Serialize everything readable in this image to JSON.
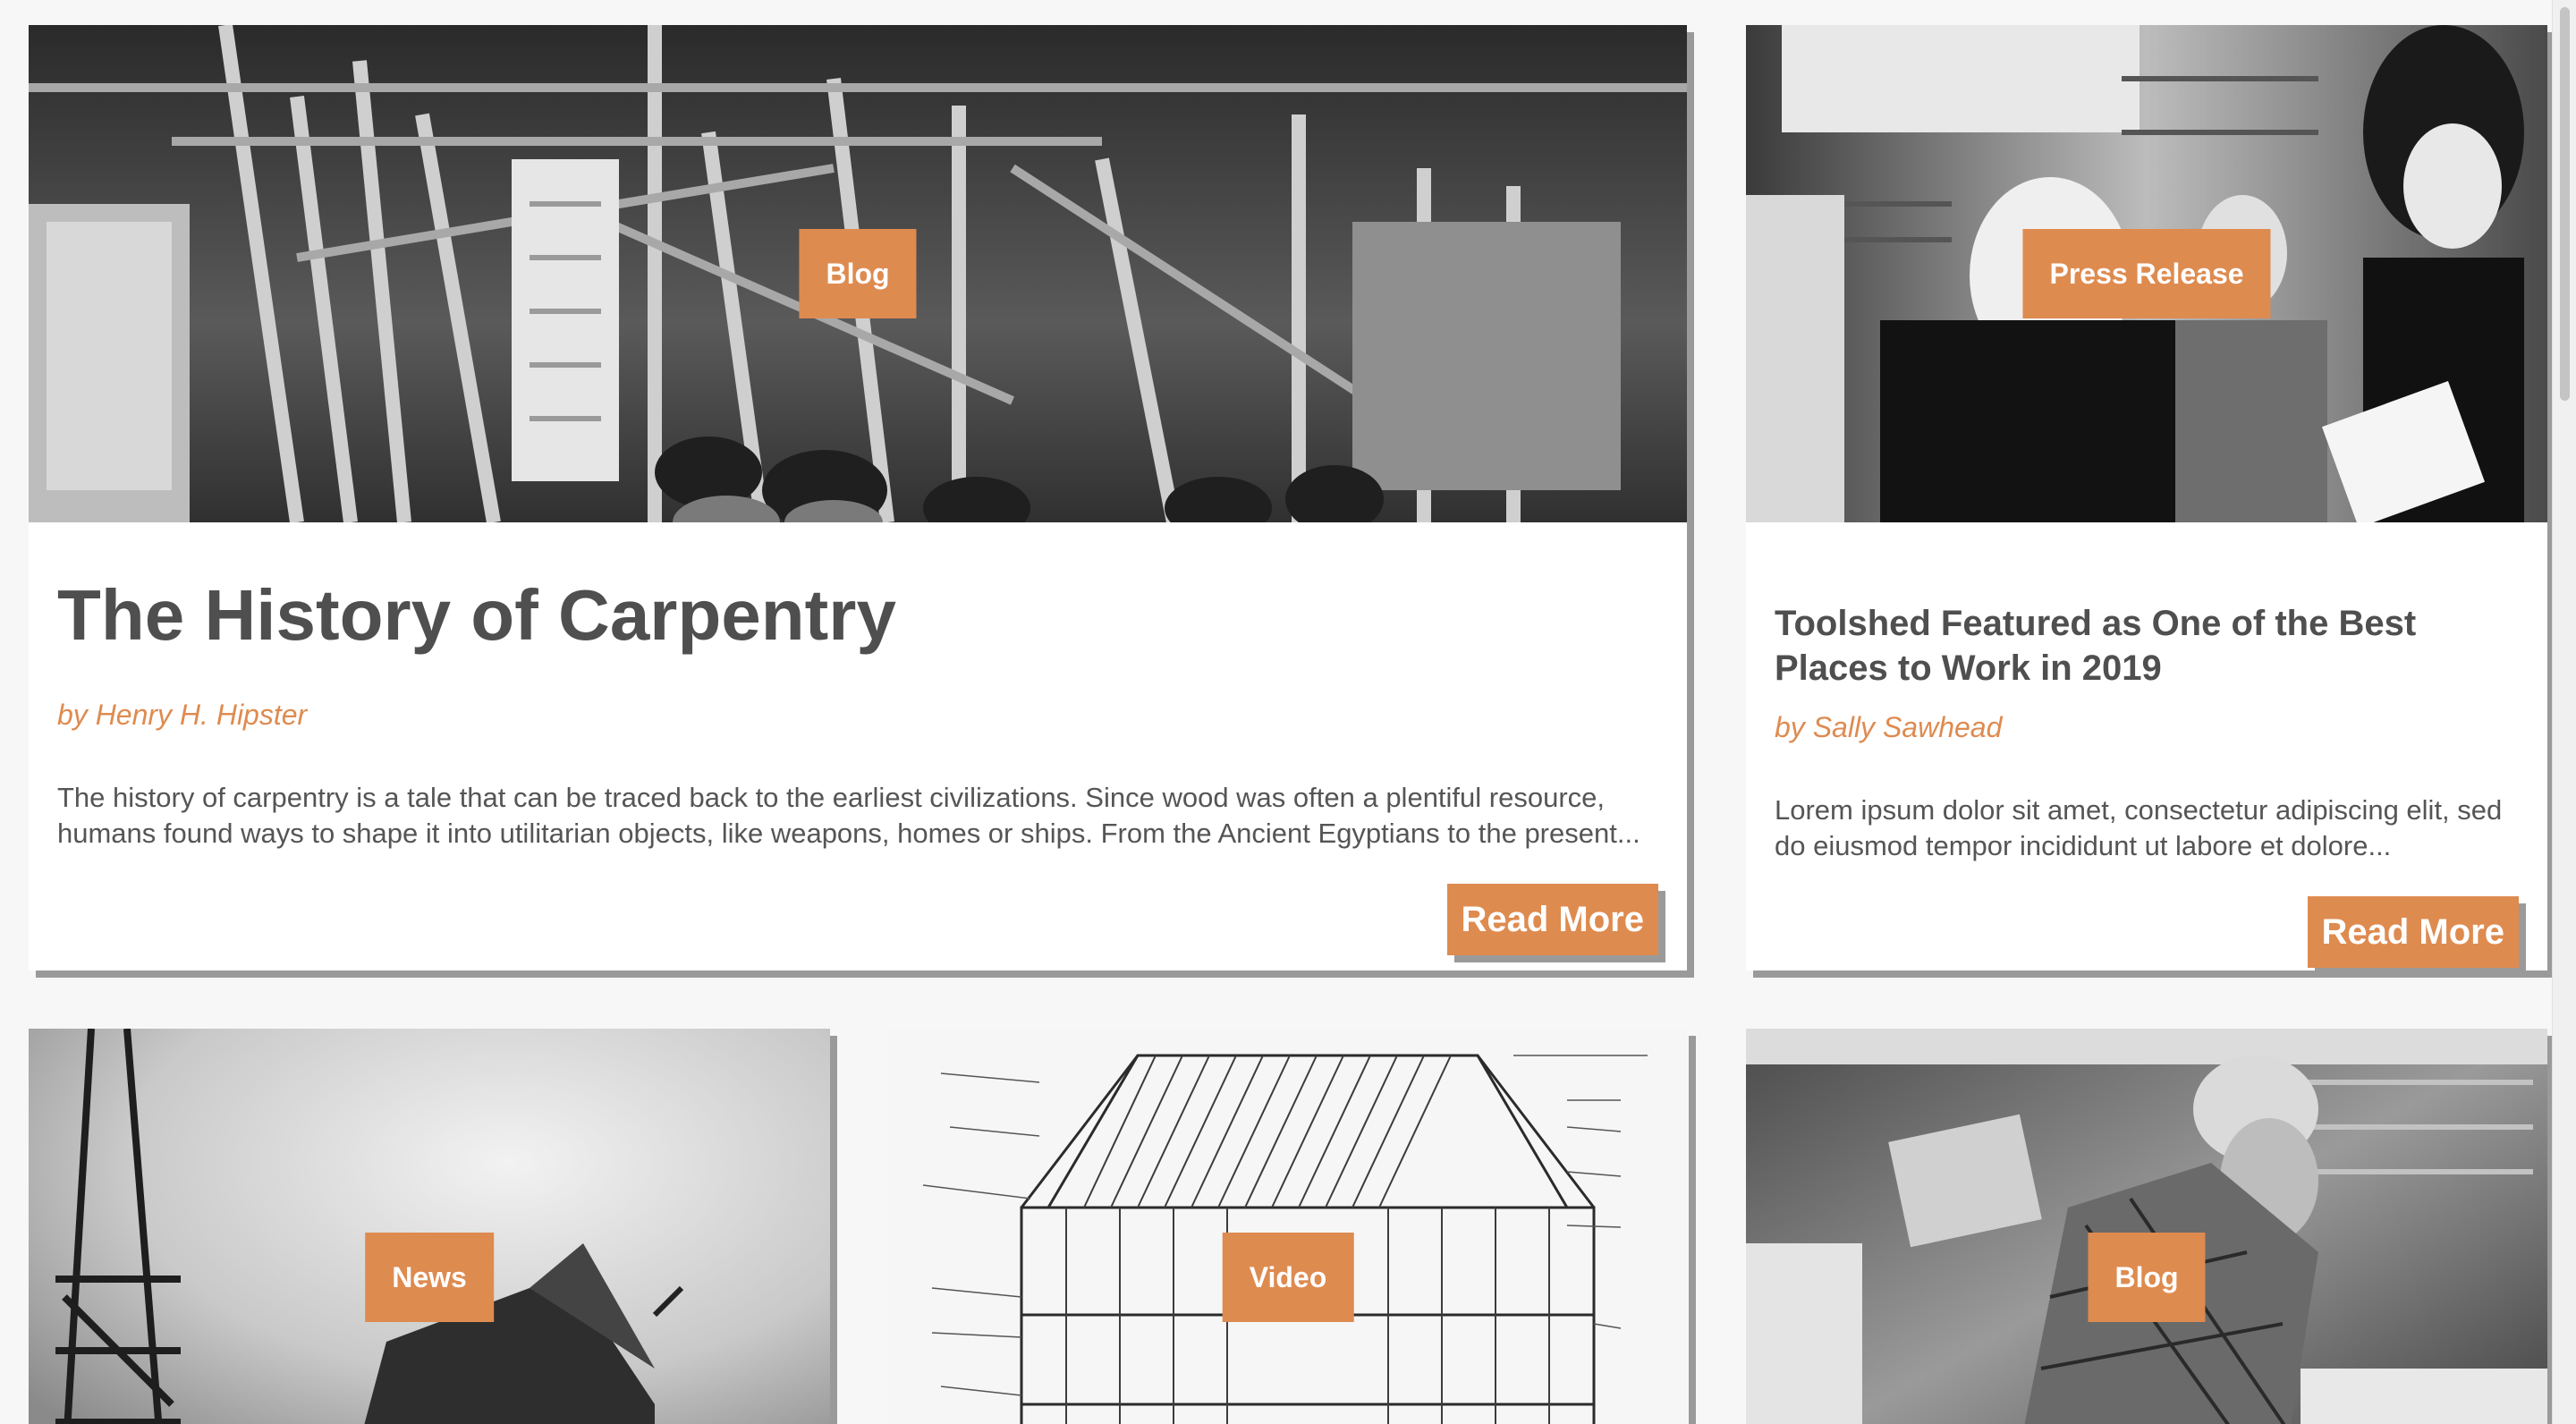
{
  "featured_card": {
    "category": "Blog",
    "title": "The History of Carpentry",
    "author": "by Henry H. Hipster",
    "excerpt": "The history of carpentry is a tale that can be traced back to the earliest civilizations. Since wood was often a plentiful resource, humans found ways to shape it into utilitarian objects, like weapons, homes or ships. From the Ancient Egyptians to the present...",
    "button_label": "Read More"
  },
  "side_card": {
    "category": "Press Release",
    "title": "Toolshed Featured as One of the Best Places to Work in 2019",
    "author": "by Sally Sawhead",
    "excerpt": "Lorem ipsum dolor sit amet, consectetur adipiscing elit, sed do eiusmod tempor incididunt ut labore et dolore...",
    "button_label": "Read More"
  },
  "bottom_cards": [
    {
      "category": "News"
    },
    {
      "category": "Video"
    },
    {
      "category": "Blog"
    }
  ],
  "colors": {
    "accent": "#de8b50",
    "title_text": "#4f4f4f",
    "body_text": "#555555",
    "shadow": "#9a9a9a",
    "background": "#f7f7f7"
  }
}
